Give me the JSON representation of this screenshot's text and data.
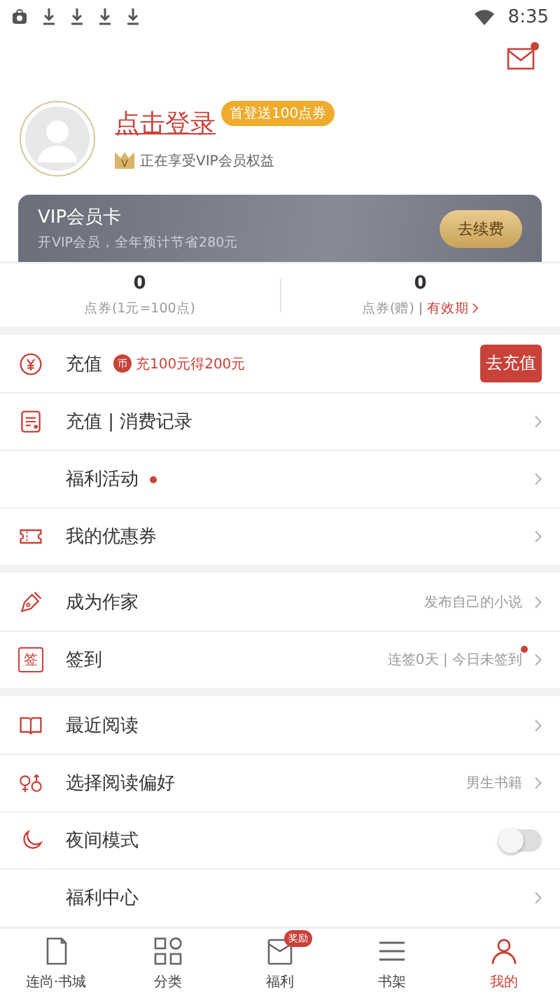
{
  "status_bar": {
    "time": "8:35"
  },
  "header": {
    "mail_unread": true
  },
  "profile": {
    "login": "点击登录",
    "promo_badge": "首登送100点券",
    "vip_note": "正在享受VIP会员权益",
    "vip_badge": "V"
  },
  "vip_card": {
    "title": "VIP会员卡",
    "subtitle": "开VIP会员，全年预计节省280元",
    "button": "去续费"
  },
  "balances": [
    {
      "value": "0",
      "label": "点券(1元=100点)"
    },
    {
      "value": "0",
      "label": "点券(赠)",
      "link": "有效期"
    }
  ],
  "sections": [
    {
      "rows": [
        {
          "kind": "button",
          "label": "充值",
          "promo_icon": "币",
          "promo": "充100元得200元",
          "button": "去充值"
        },
        {
          "kind": "chevron",
          "label": "充值 | 消费记录"
        },
        {
          "kind": "chevron",
          "label": "福利活动",
          "dot": true
        },
        {
          "kind": "chevron",
          "label": "我的优惠券"
        }
      ]
    },
    {
      "rows": [
        {
          "kind": "chevron",
          "label": "成为作家",
          "value": "发布自己的小说"
        },
        {
          "kind": "chevron",
          "label": "签到",
          "icon_text": "签",
          "value": "连签0天 | 今日未签到",
          "value_dot": true
        }
      ]
    },
    {
      "rows": [
        {
          "kind": "chevron",
          "label": "最近阅读"
        },
        {
          "kind": "chevron",
          "label": "选择阅读偏好",
          "value": "男生书籍"
        },
        {
          "kind": "toggle",
          "label": "夜间模式",
          "on": false
        },
        {
          "kind": "chevron",
          "label": "福利中心"
        }
      ]
    }
  ],
  "bottom_nav": [
    {
      "label": "连尚·书城",
      "selected": false
    },
    {
      "label": "分类",
      "selected": false
    },
    {
      "label": "福利",
      "badge": "奖励",
      "selected": false
    },
    {
      "label": "书架",
      "selected": false
    },
    {
      "label": "我的",
      "selected": true
    }
  ]
}
